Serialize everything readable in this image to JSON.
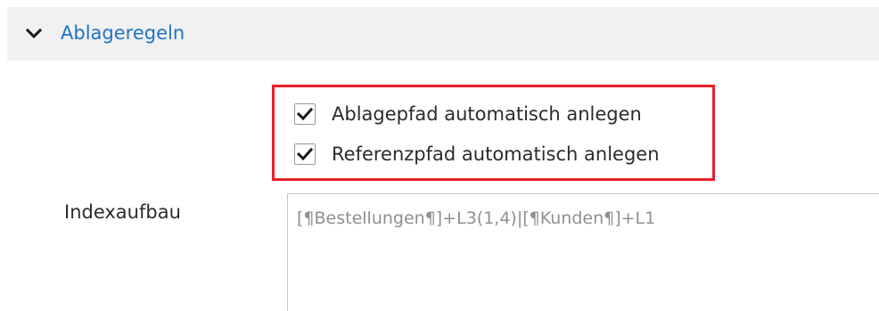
{
  "section": {
    "title": "Ablageregeln",
    "toggle_icon": "chevron-down-icon"
  },
  "options": [
    {
      "label": "Ablagepfad automatisch anlegen",
      "checked": true
    },
    {
      "label": "Referenzpfad automatisch anlegen",
      "checked": true
    }
  ],
  "index": {
    "label": "Indexaufbau",
    "value": "[¶Bestellungen¶]+L3(1,4)|[¶Kunden¶]+L1"
  },
  "colors": {
    "accent": "#1f73c6",
    "highlight": "#e8202a",
    "header_bg": "#f1f1f1",
    "text": "#2b2b2b",
    "muted_text": "#8f8f8f"
  }
}
